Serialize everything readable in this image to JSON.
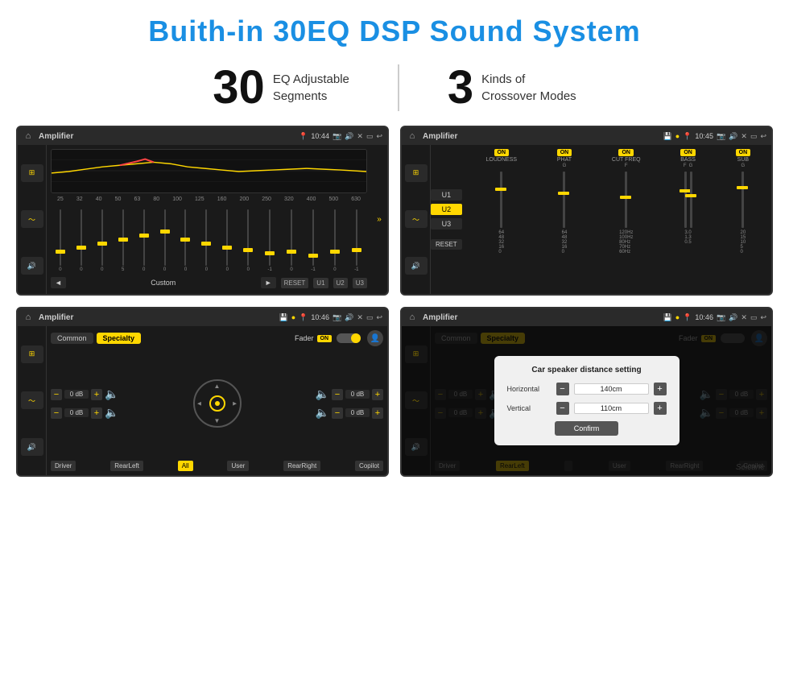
{
  "header": {
    "title": "Buith-in 30EQ DSP Sound System"
  },
  "stats": [
    {
      "number": "30",
      "label_line1": "EQ Adjustable",
      "label_line2": "Segments"
    },
    {
      "number": "3",
      "label_line1": "Kinds of",
      "label_line2": "Crossover Modes"
    }
  ],
  "screens": [
    {
      "id": "screen-top-left",
      "topbar": {
        "title": "Amplifier",
        "time": "10:44"
      },
      "type": "eq"
    },
    {
      "id": "screen-top-right",
      "topbar": {
        "title": "Amplifier",
        "time": "10:45"
      },
      "type": "crossover"
    },
    {
      "id": "screen-bottom-left",
      "topbar": {
        "title": "Amplifier",
        "time": "10:46"
      },
      "type": "speaker"
    },
    {
      "id": "screen-bottom-right",
      "topbar": {
        "title": "Amplifier",
        "time": "10:46"
      },
      "type": "speaker-dialog"
    }
  ],
  "eq": {
    "freq_labels": [
      "25",
      "32",
      "40",
      "50",
      "63",
      "80",
      "100",
      "125",
      "160",
      "200",
      "250",
      "320",
      "400",
      "500",
      "630"
    ],
    "slider_values": [
      "0",
      "0",
      "0",
      "5",
      "0",
      "0",
      "0",
      "0",
      "0",
      "0",
      "-1",
      "0",
      "-1"
    ],
    "controls": {
      "prev": "◄",
      "label": "Custom",
      "next": "►",
      "reset": "RESET",
      "presets": [
        "U1",
        "U2",
        "U3"
      ]
    }
  },
  "crossover": {
    "presets": [
      "U1",
      "U2",
      "U3"
    ],
    "reset": "RESET",
    "modules": [
      {
        "label": "LOUDNESS",
        "on": true
      },
      {
        "label": "PHAT",
        "on": true
      },
      {
        "label": "CUT FREQ",
        "on": true
      },
      {
        "label": "BASS",
        "on": true
      },
      {
        "label": "SUB",
        "on": true
      }
    ]
  },
  "speaker": {
    "tabs": [
      "Common",
      "Specialty"
    ],
    "active_tab": "Specialty",
    "fader_label": "Fader",
    "fader_on": "ON",
    "channels": [
      {
        "label": "0 dB"
      },
      {
        "label": "0 dB"
      },
      {
        "label": "0 dB"
      },
      {
        "label": "0 dB"
      }
    ],
    "zones": [
      "Driver",
      "RearLeft",
      "All",
      "User",
      "RearRight",
      "Copilot"
    ]
  },
  "dialog": {
    "title": "Car speaker distance setting",
    "horizontal_label": "Horizontal",
    "horizontal_value": "140cm",
    "vertical_label": "Vertical",
    "vertical_value": "110cm",
    "confirm_label": "Confirm"
  },
  "watermark": "Seicane"
}
